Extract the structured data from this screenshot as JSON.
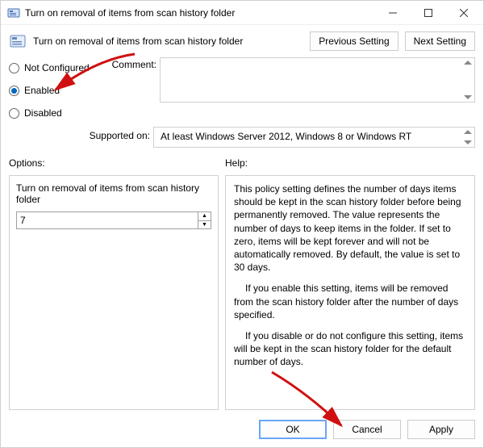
{
  "window": {
    "title": "Turn on removal of items from scan history folder"
  },
  "header": {
    "title": "Turn on removal of items from scan history folder",
    "prev_btn": "Previous Setting",
    "next_btn": "Next Setting"
  },
  "state": {
    "not_configured_label": "Not Configured",
    "enabled_label": "Enabled",
    "disabled_label": "Disabled",
    "selected": "enabled"
  },
  "comment": {
    "label": "Comment:",
    "value": ""
  },
  "supported": {
    "label": "Supported on:",
    "value": "At least Windows Server 2012, Windows 8 or Windows RT"
  },
  "options": {
    "header": "Options:",
    "setting_label": "Turn on removal of items from scan history folder",
    "value": "7"
  },
  "help": {
    "header": "Help:",
    "p1": "This policy setting defines the number of days items should be kept in the scan history folder before being permanently removed. The value represents the number of days to keep items in the folder. If set to zero, items will be kept forever and will not be automatically removed. By default, the value is set to 30 days.",
    "p2": "If you enable this setting, items will be removed from the scan history folder after the number of days specified.",
    "p3": "If you disable or do not configure this setting, items will be kept in the scan history folder for the default number of days."
  },
  "footer": {
    "ok": "OK",
    "cancel": "Cancel",
    "apply": "Apply"
  },
  "colors": {
    "annotation_arrow": "#d01010"
  }
}
